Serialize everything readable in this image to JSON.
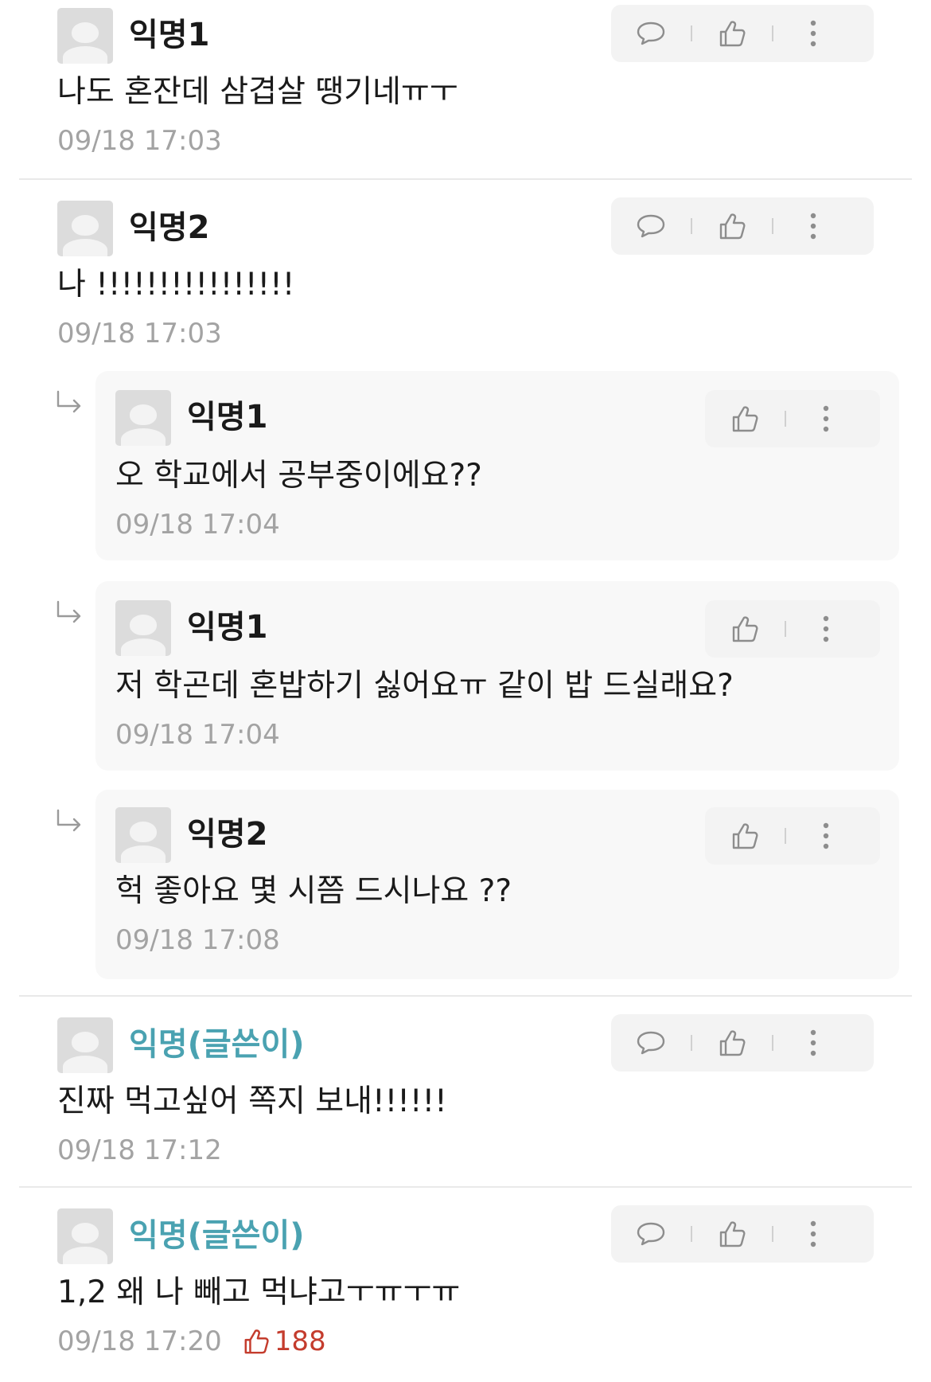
{
  "icons": {
    "reply": "speech-bubble-icon",
    "like": "thumbs-up-icon",
    "more": "vertical-dots-icon",
    "nested": "reply-arrow-icon"
  },
  "colors": {
    "author": "#4aa2b1",
    "like_count": "#c43c2d",
    "meta": "#a3a3a3",
    "reply_bg": "#f8f8f8",
    "action_bg": "#f3f3f3"
  },
  "comments": [
    {
      "nickname": "익명1",
      "is_author": false,
      "text": "나도 혼잔데 삼겹살 땡기네ㅠㅜ",
      "time": "09/18 17:03"
    },
    {
      "nickname": "익명2",
      "is_author": false,
      "text": "나 !!!!!!!!!!!!!!!!",
      "time": "09/18 17:03",
      "replies": [
        {
          "nickname": "익명1",
          "text": "오 학교에서 공부중이에요??",
          "time": "09/18 17:04"
        },
        {
          "nickname": "익명1",
          "text": "저 학곤데 혼밥하기 싫어요ㅠ 같이 밥 드실래요?",
          "time": "09/18 17:04"
        },
        {
          "nickname": "익명2",
          "text": "헉 좋아요 몇 시쯤 드시나요 ??",
          "time": "09/18 17:08"
        }
      ]
    },
    {
      "nickname": "익명(글쓴이)",
      "is_author": true,
      "text": "진짜 먹고싶어 쪽지 보내!!!!!!",
      "time": "09/18 17:12"
    },
    {
      "nickname": "익명(글쓴이)",
      "is_author": true,
      "text": "1,2 왜 나 빼고 먹냐고ㅜㅠㅜㅠ",
      "time": "09/18 17:20",
      "likes": "188"
    }
  ]
}
